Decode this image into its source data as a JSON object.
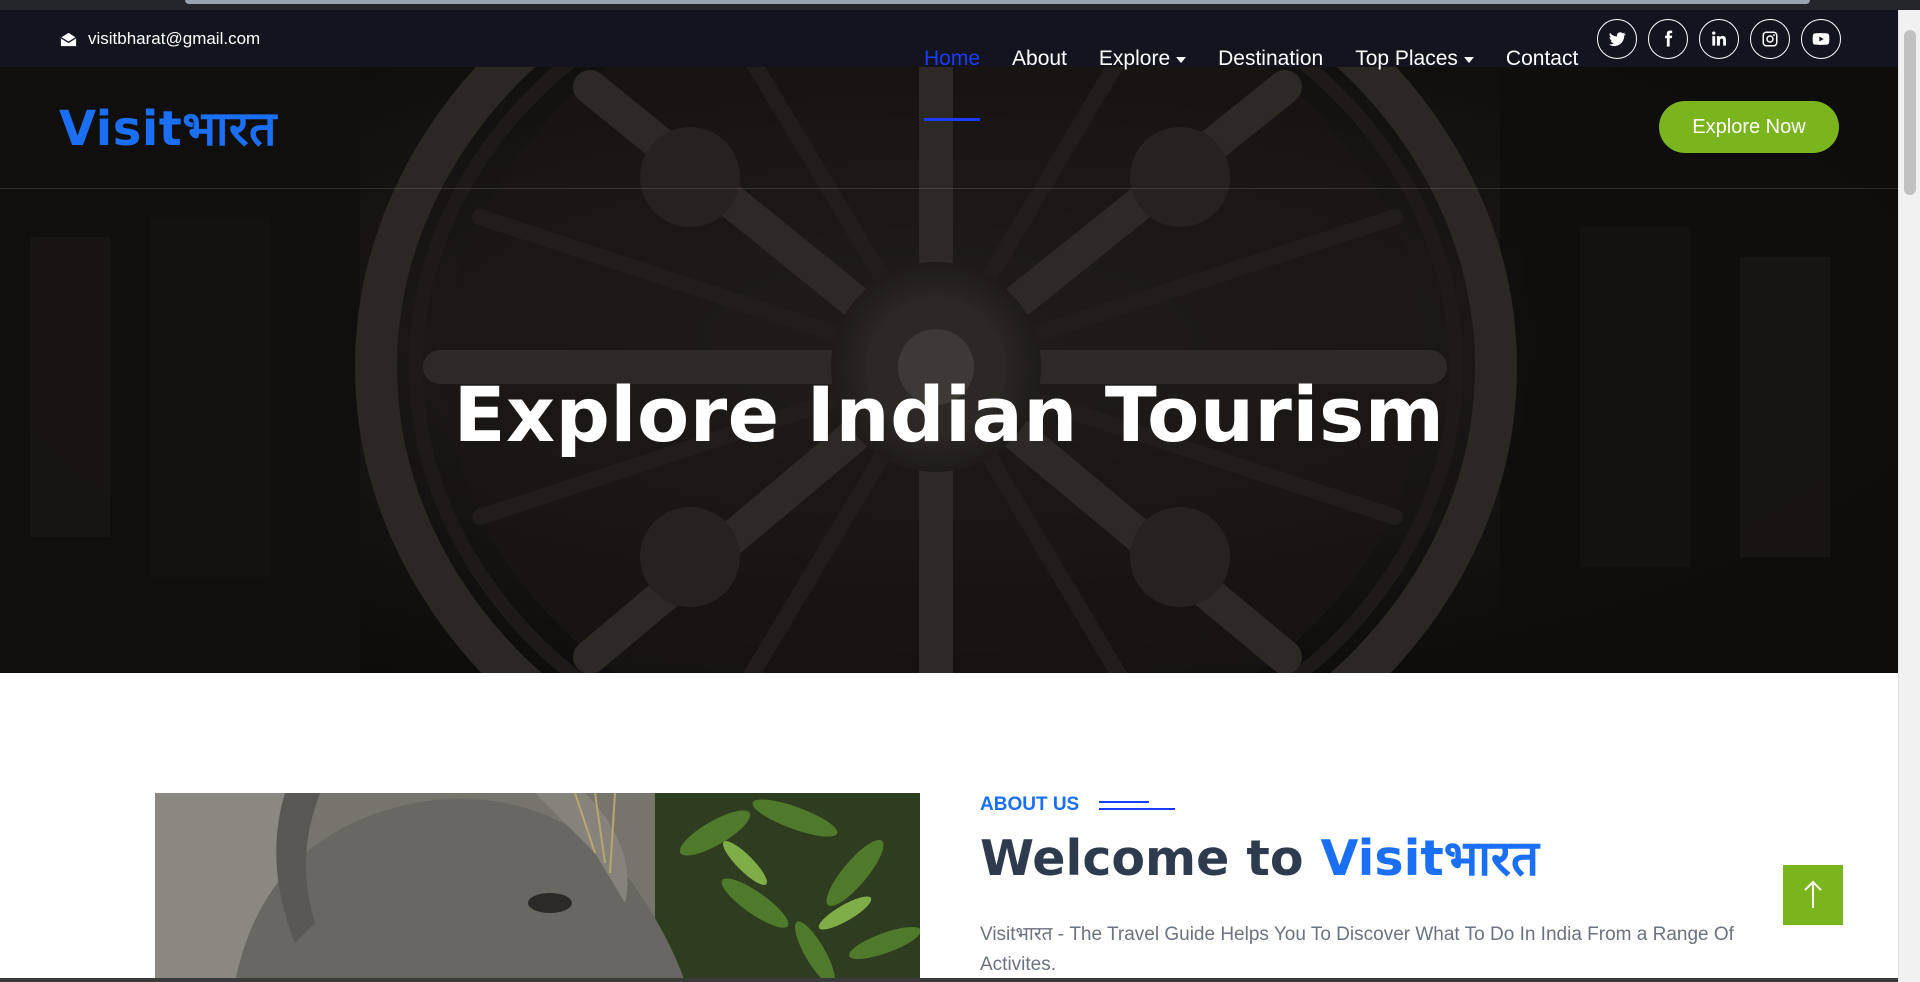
{
  "topbar": {
    "email": "visitbharat@gmail.com",
    "email_icon": "envelope-open-icon",
    "socials": [
      {
        "name": "twitter",
        "icon": "twitter-icon"
      },
      {
        "name": "facebook",
        "icon": "facebook-icon"
      },
      {
        "name": "linkedin",
        "icon": "linkedin-icon"
      },
      {
        "name": "instagram",
        "icon": "instagram-icon"
      },
      {
        "name": "youtube",
        "icon": "youtube-icon"
      }
    ]
  },
  "navbar": {
    "logo": "Visitभारत",
    "items": [
      {
        "label": "Home",
        "active": true,
        "dropdown": false
      },
      {
        "label": "About",
        "active": false,
        "dropdown": false
      },
      {
        "label": "Explore",
        "active": false,
        "dropdown": true
      },
      {
        "label": "Destination",
        "active": false,
        "dropdown": false
      },
      {
        "label": "Top Places",
        "active": false,
        "dropdown": true
      },
      {
        "label": "Contact",
        "active": false,
        "dropdown": false
      }
    ],
    "cta": "Explore Now"
  },
  "hero": {
    "title": "Explore Indian Tourism"
  },
  "about": {
    "label": "ABOUT US",
    "title_prefix": "Welcome to",
    "title_brand": "Visitभारत",
    "description": "Visitभारत - The Travel Guide Helps You To Discover What To Do In India From a Range Of Activites."
  },
  "colors": {
    "brand_blue": "#1a6ff5",
    "active_nav": "#1a3cff",
    "accent_green": "#7bb51e",
    "topbar_bg": "#14141f",
    "heading_dark": "#2e3a4e"
  }
}
